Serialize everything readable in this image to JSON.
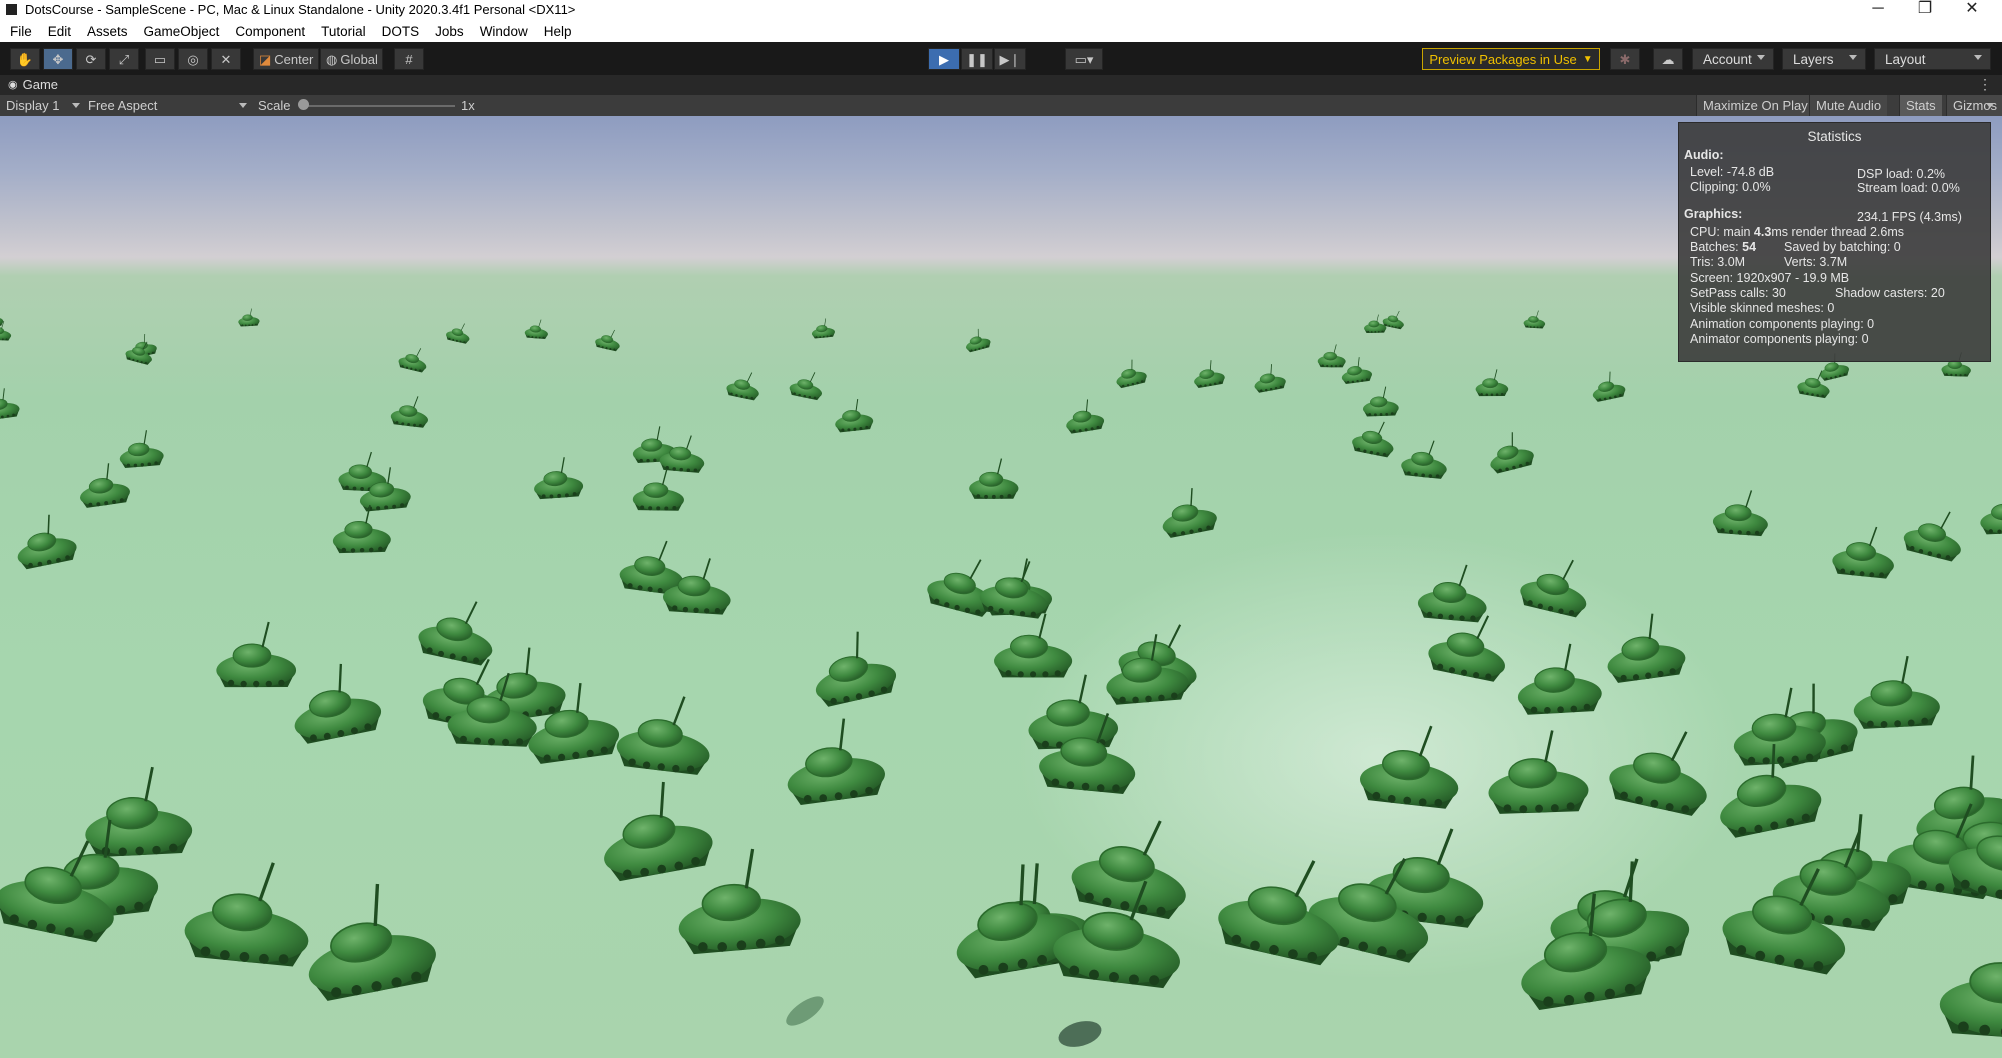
{
  "window": {
    "title": "DotsCourse - SampleScene - PC, Mac & Linux Standalone - Unity 2020.3.4f1 Personal <DX11>",
    "controls": {
      "minimize": "─",
      "maximize": "❐",
      "close": "✕"
    }
  },
  "menubar": [
    "File",
    "Edit",
    "Assets",
    "GameObject",
    "Component",
    "Tutorial",
    "DOTS",
    "Jobs",
    "Window",
    "Help"
  ],
  "toolbar": {
    "tools": [
      "hand-tool",
      "move-tool",
      "rotate-tool",
      "scale-tool",
      "rect-tool",
      "transform-tool",
      "custom-tool"
    ],
    "pivot_label": "Center",
    "space_label": "Global",
    "play_state": "playing",
    "preview_packages": "Preview Packages in Use",
    "account": "Account",
    "layers": "Layers",
    "layout": "Layout"
  },
  "game_tab": {
    "label": "Game"
  },
  "game_toolbar": {
    "display": "Display 1",
    "aspect": "Free Aspect",
    "scale_label": "Scale",
    "scale_value": "1x",
    "maximize_on_play": "Maximize On Play",
    "mute_audio": "Mute Audio",
    "stats": "Stats",
    "gizmos": "Gizmos",
    "stats_enabled": true
  },
  "statistics": {
    "title": "Statistics",
    "audio_header": "Audio:",
    "level": "Level: -74.8 dB",
    "clipping": "Clipping: 0.0%",
    "dsp_load": "DSP load: 0.2%",
    "stream_load": "Stream load: 0.0%",
    "graphics_header": "Graphics:",
    "fps": "234.1 FPS (4.3ms)",
    "cpu_prefix": "CPU: main",
    "cpu_main": "4.3",
    "cpu_suffix": "ms  render thread 2.6ms",
    "batches_prefix": "Batches:",
    "batches": "54",
    "saved_batching": "Saved by batching: 0",
    "tris": "Tris: 3.0M",
    "verts": "Verts: 3.7M",
    "screen": "Screen: 1920x907 - 19.9 MB",
    "setpass": "SetPass calls: 30",
    "shadow_casters": "Shadow casters: 20",
    "visible_skinned": "Visible skinned meshes: 0",
    "animation_components": "Animation components playing: 0",
    "animator_components": "Animator components playing: 0"
  },
  "scene": {
    "sky_color": "#9aa6c4",
    "ground_color": "#a6d4ad",
    "tank_color": "#3f8a40",
    "tank_count": 110
  }
}
